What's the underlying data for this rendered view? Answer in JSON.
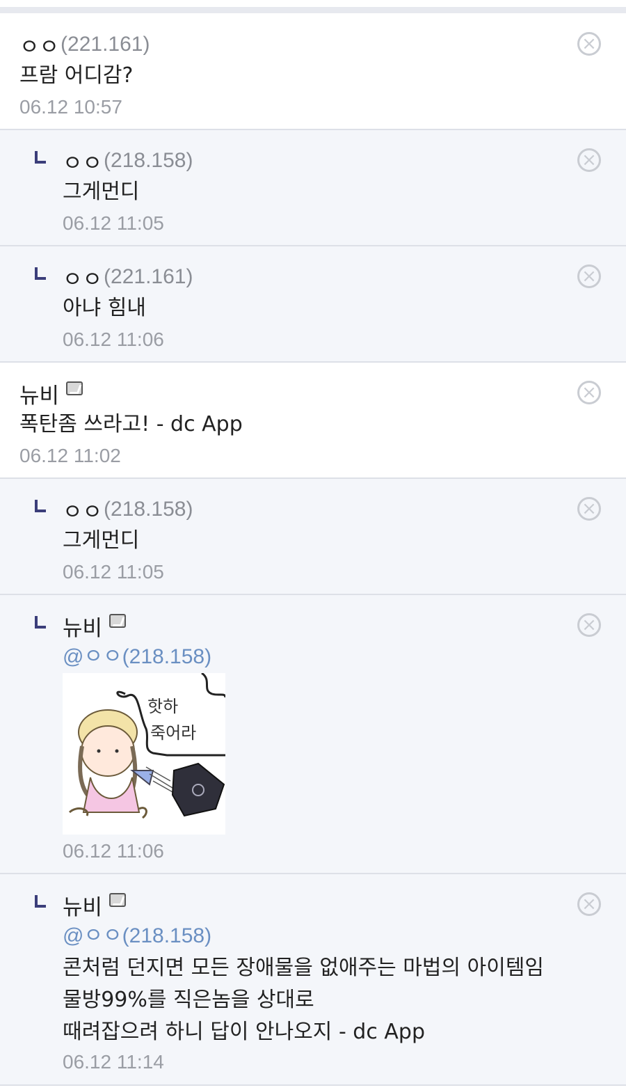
{
  "comments": [
    {
      "nick": "ㅇㅇ",
      "ip": "(221.161)",
      "text": "프람 어디감?",
      "time": "06.12 10:57"
    },
    {
      "nick": "ㅇㅇ",
      "ip": "(218.158)",
      "text": "그게먼디",
      "time": "06.12 11:05"
    },
    {
      "nick": "ㅇㅇ",
      "ip": "(221.161)",
      "text": "아냐 힘내",
      "time": "06.12 11:06"
    },
    {
      "nick": "뉴비",
      "ip": "",
      "text": "폭탄좀 쓰라고! - dc App",
      "time": "06.12 11:02"
    },
    {
      "nick": "ㅇㅇ",
      "ip": "(218.158)",
      "text": "그게먼디",
      "time": "06.12 11:05"
    },
    {
      "nick": "뉴비",
      "ip": "",
      "mention": "@ㅇㅇ(218.158)",
      "sticker_text": [
        "핫하",
        "죽어라"
      ],
      "time": "06.12 11:06"
    },
    {
      "nick": "뉴비",
      "ip": "",
      "mention": "@ㅇㅇ(218.158)",
      "lines": [
        "콘처럼 던지면 모든 장애물을 없애주는 마법의 아이템임",
        "물방99%를 직은놈을 상대로",
        "때려잡으려 하니 답이 안나오지 - dc App"
      ],
      "time": "06.12 11:14"
    }
  ],
  "icons": {
    "close": "⊗"
  },
  "colors": {
    "reply_bg": "#f4f6fa",
    "mention": "#6a8fc2",
    "reply_mark": "#3b3e7a"
  }
}
